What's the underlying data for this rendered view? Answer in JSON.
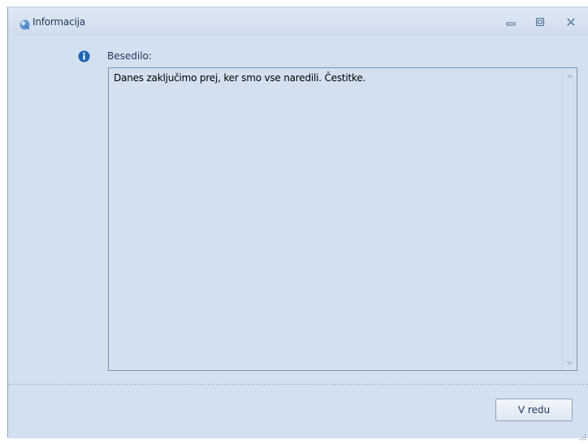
{
  "window": {
    "title": "Informacija",
    "icon": "app-logo-icon",
    "controls": [
      "minimize-icon",
      "maximize-icon",
      "close-icon"
    ]
  },
  "message": {
    "icon": "info-icon",
    "label": "Besedilo:",
    "text": "Danes zaključimo prej, ker smo vse naredili. Čestitke."
  },
  "buttons": {
    "ok_label": "V redu"
  },
  "colors": {
    "background": "#d3e0ef",
    "title_text": "#1e395b",
    "info_icon": "#1f64b5"
  }
}
